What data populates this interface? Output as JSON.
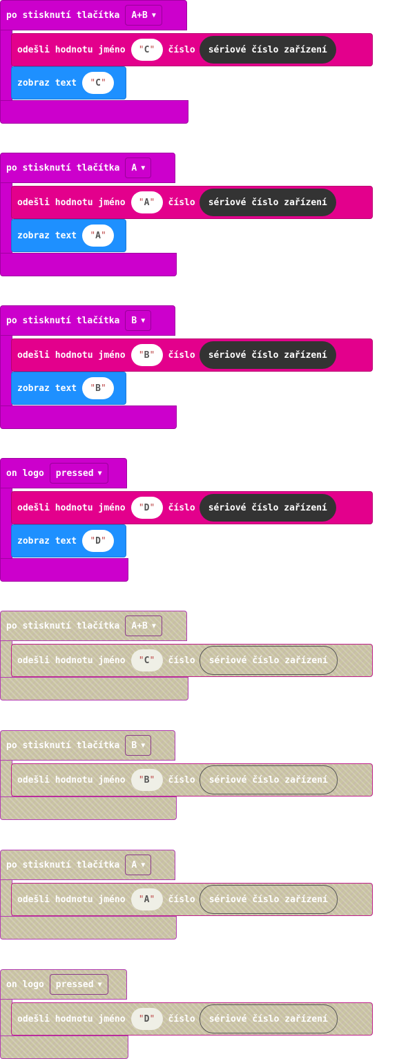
{
  "blocks": [
    {
      "state": "active",
      "event": "po stisknutí tlačítka",
      "option": "A+B",
      "send_label": "odešli hodnotu jméno",
      "name_value": "C",
      "number_label": "číslo",
      "serial": "sériové číslo zařízení",
      "show_label": "zobraz text",
      "show_value": "C"
    },
    {
      "state": "active",
      "event": "po stisknutí tlačítka",
      "option": "A",
      "send_label": "odešli hodnotu jméno",
      "name_value": "A",
      "number_label": "číslo",
      "serial": "sériové číslo zařízení",
      "show_label": "zobraz text",
      "show_value": "A"
    },
    {
      "state": "active",
      "event": "po stisknutí tlačítka",
      "option": "B",
      "send_label": "odešli hodnotu jméno",
      "name_value": "B",
      "number_label": "číslo",
      "serial": "sériové číslo zařízení",
      "show_label": "zobraz text",
      "show_value": "B"
    },
    {
      "state": "active",
      "event": "on logo",
      "option": "pressed",
      "send_label": "odešli hodnotu jméno",
      "name_value": "D",
      "number_label": "číslo",
      "serial": "sériové číslo zařízení",
      "show_label": "zobraz text",
      "show_value": "D"
    },
    {
      "state": "disabled",
      "event": "po stisknutí tlačítka",
      "option": "A+B",
      "send_label": "odešli hodnotu jméno",
      "name_value": "C",
      "number_label": "číslo",
      "serial": "sériové číslo zařízení"
    },
    {
      "state": "disabled",
      "event": "po stisknutí tlačítka",
      "option": "B",
      "send_label": "odešli hodnotu jméno",
      "name_value": "B",
      "number_label": "číslo",
      "serial": "sériové číslo zařízení"
    },
    {
      "state": "disabled",
      "event": "po stisknutí tlačítka",
      "option": "A",
      "send_label": "odešli hodnotu jméno",
      "name_value": "A",
      "number_label": "číslo",
      "serial": "sériové číslo zařízení"
    },
    {
      "state": "disabled",
      "event": "on logo",
      "option": "pressed",
      "send_label": "odešli hodnotu jméno",
      "name_value": "D",
      "number_label": "číslo",
      "serial": "sériové číslo zařízení"
    }
  ],
  "colors": {
    "event_block": "#cc00cc",
    "radio_block": "#e3008c",
    "basic_block": "#1e90ff",
    "reporter": "#333333",
    "disabled_fill": "#c9c4a2"
  }
}
